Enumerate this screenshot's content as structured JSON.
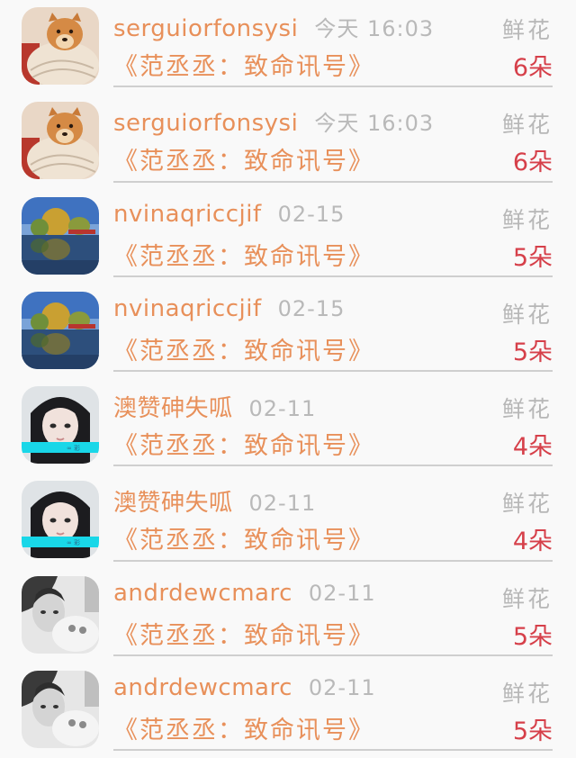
{
  "rows": [
    {
      "name": "serguiorfonsysi",
      "time": "今天 16:03",
      "title": "《范丞丞：致命讯号》",
      "gift_label": "鲜花",
      "gift_count": "6朵",
      "avatar": "dog"
    },
    {
      "name": "serguiorfonsysi",
      "time": "今天 16:03",
      "title": "《范丞丞：致命讯号》",
      "gift_label": "鲜花",
      "gift_count": "6朵",
      "avatar": "dog"
    },
    {
      "name": "nvinaqriccjif",
      "time": "02-15",
      "title": "《范丞丞：致命讯号》",
      "gift_label": "鲜花",
      "gift_count": "5朵",
      "avatar": "lake"
    },
    {
      "name": "nvinaqriccjif",
      "time": "02-15",
      "title": "《范丞丞：致命讯号》",
      "gift_label": "鲜花",
      "gift_count": "5朵",
      "avatar": "lake"
    },
    {
      "name": "澳赞砷失呱",
      "time": "02-11",
      "title": "《范丞丞：致命讯号》",
      "gift_label": "鲜花",
      "gift_count": "4朵",
      "avatar": "girl"
    },
    {
      "name": "澳赞砷失呱",
      "time": "02-11",
      "title": "《范丞丞：致命讯号》",
      "gift_label": "鲜花",
      "gift_count": "4朵",
      "avatar": "girl"
    },
    {
      "name": "andrdewcmarc",
      "time": "02-11",
      "title": "《范丞丞：致命讯号》",
      "gift_label": "鲜花",
      "gift_count": "5朵",
      "avatar": "bw"
    },
    {
      "name": "andrdewcmarc",
      "time": "02-11",
      "title": "《范丞丞：致命讯号》",
      "gift_label": "鲜花",
      "gift_count": "5朵",
      "avatar": "bw"
    }
  ],
  "colors": {
    "name": "#e8905a",
    "time": "#b9b9b9",
    "count": "#d6404a",
    "divider": "#cfcfcf"
  }
}
